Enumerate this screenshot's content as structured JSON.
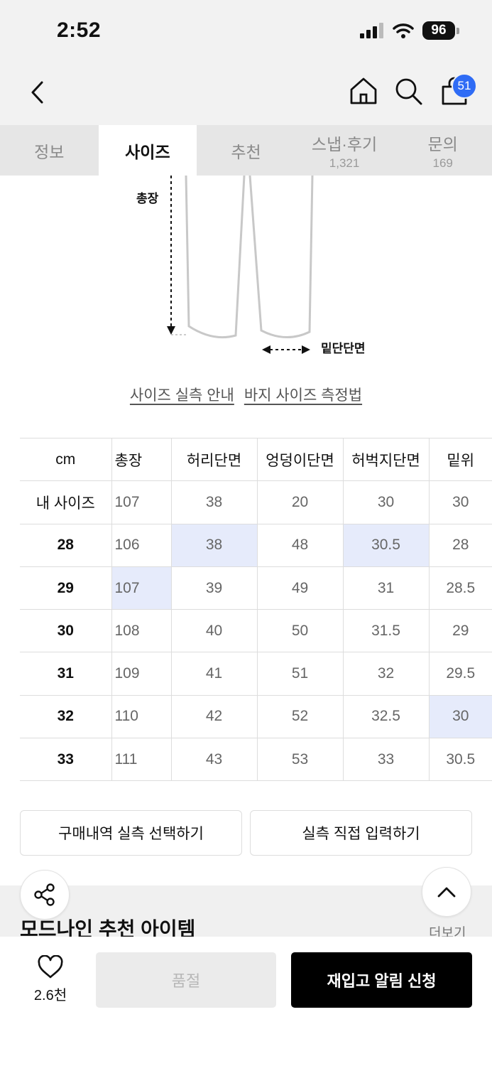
{
  "status_bar": {
    "time": "2:52",
    "battery": "96"
  },
  "nav": {
    "cart_count": "51"
  },
  "tabs": [
    {
      "label": "정보",
      "sub": ""
    },
    {
      "label": "사이즈",
      "sub": ""
    },
    {
      "label": "추천",
      "sub": ""
    },
    {
      "label": "스냅·후기",
      "sub": "1,321"
    },
    {
      "label": "문의",
      "sub": "169"
    }
  ],
  "diagram": {
    "total_length_label": "총장",
    "hem_label": "밑단단면"
  },
  "links": {
    "size_guide": "사이즈 실측 안내",
    "measure_method": "바지 사이즈 측정법"
  },
  "size_table": {
    "headers": [
      "cm",
      "총장",
      "허리단면",
      "엉덩이단면",
      "허벅지단면",
      "밑위"
    ],
    "rows": [
      [
        "내 사이즈",
        "107",
        "38",
        "20",
        "30",
        "30"
      ],
      [
        "28",
        "106",
        "38",
        "48",
        "30.5",
        "28"
      ],
      [
        "29",
        "107",
        "39",
        "49",
        "31",
        "28.5"
      ],
      [
        "30",
        "108",
        "40",
        "50",
        "31.5",
        "29"
      ],
      [
        "31",
        "109",
        "41",
        "51",
        "32",
        "29.5"
      ],
      [
        "32",
        "110",
        "42",
        "52",
        "32.5",
        "30"
      ],
      [
        "33",
        "111",
        "43",
        "53",
        "33",
        "30.5"
      ]
    ],
    "highlight_color": "#e6ebfb"
  },
  "buttons": {
    "purchase_history": "구매내역 실측 선택하기",
    "direct_input": "실측 직접 입력하기"
  },
  "recommend": {
    "title": "모드나인 추천 아이템",
    "more": "더보기"
  },
  "bottom_bar": {
    "like_count": "2.6천",
    "soldout": "품절",
    "restock": "재입고 알림 신청"
  },
  "colors": {
    "accent": "#2f6cf5",
    "cta": "#000000"
  }
}
